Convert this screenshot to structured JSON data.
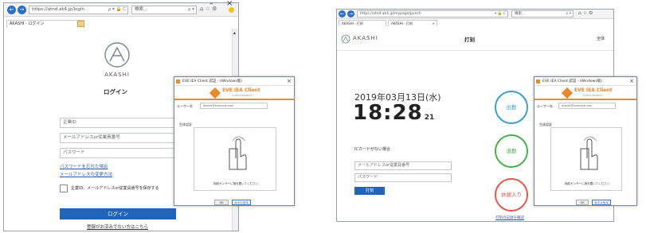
{
  "left_browser": {
    "back_arrow": "←",
    "forward_arrow": "→",
    "address": "https://atnd.ak4.jp/login",
    "address_icons": "ρ ▾ 🔒 C",
    "search_placeholder": "検索...",
    "search_icon": "ρ ▾",
    "toolbar_icons": "⌂ ☆ ⚙",
    "tab_label": "AKASHI - ログイン",
    "tab_close": "×",
    "window_controls": {
      "minimize": "–",
      "close": "×"
    }
  },
  "login": {
    "brand": "AKASHI",
    "heading": "ログイン",
    "company_id_placeholder": "企業ID",
    "email_placeholder": "メールアドレスor従業員番号",
    "password_placeholder": "パスワード",
    "forgot_password_link": "パスワードを忘れた場合",
    "change_email_link": "メールアドレスの変更方法",
    "remember_label": "企業ID、メールアドレスor従業員番号を保存する",
    "login_button": "ログイン",
    "first_time_link": "登録がお済みでない方はこちら"
  },
  "dialog_left": {
    "title": "EVE IEA Client 認証 - (Windows版)",
    "logo_text": "EVE IEA Client",
    "logo_sub": "Authentication",
    "user_label": "ユーザー名",
    "user_value": "akashi@example.com",
    "section_label": "生体認証",
    "instruction": "指紋センサーに指を置いてください",
    "ok_button": "OK",
    "cancel_button": "キャンセル",
    "close_icon": "×"
  },
  "right_browser": {
    "address": "https://atnd.ak4.jp/mypage/punch",
    "address_icons": "▾ 🔒 C",
    "search_placeholder": "検索...",
    "search_icon": "ρ ▾",
    "toolbar_icons": "⌂ ☆ ⚙",
    "tab1_label": "AKASHI - 打刻",
    "tab2_label": "AKASHI - 打刻",
    "tab_close": "×"
  },
  "punch": {
    "brand": "AKASHI",
    "title": "打刻",
    "user_menu": "全体",
    "date": "2019年03月13日(水)",
    "time": "18:28",
    "seconds": "21",
    "ic_label": "ICカードがない場合",
    "email_placeholder": "メールアドレスor従業員番号",
    "password_placeholder": "パスワード",
    "punch_button": "打刻",
    "clock_in": "出勤",
    "clock_out": "退勤",
    "break_in": "休憩入り",
    "history_link": "打刻の記録を確認"
  },
  "dialog_right": {
    "title": "EVE IEA Client 認証 - (Windows版)",
    "logo_text": "EVE IEA Client",
    "logo_sub": "Authentication",
    "user_label": "ユーザー名",
    "user_value": "akashi@example.com",
    "section_label": "生体認証",
    "instruction": "指紋センサーに指を置いてください",
    "ok_button": "OK",
    "cancel_button": "キャンセル",
    "close_icon": "×"
  },
  "colors": {
    "accent_blue": "#2265b8",
    "clock_in": "#3aa1c9",
    "clock_out": "#47b24a",
    "break_in": "#e05a4f",
    "logo_orange": "#e8892a"
  }
}
